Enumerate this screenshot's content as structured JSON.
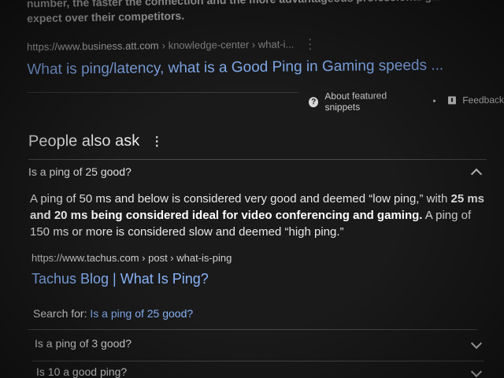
{
  "top_snippet": {
    "line1": "number, the faster the connection and the more advantageous professional gamers can",
    "line2": "expect over their competitors."
  },
  "result": {
    "cite_domain": "https://www.business.att.com",
    "cite_path": "› knowledge-center › what-i...",
    "title": "What is ping/latency, what is a Good Ping in Gaming speeds ..."
  },
  "featured_bar": {
    "about_label": "About featured snippets",
    "feedback_label": "Feedback"
  },
  "paa": {
    "heading": "People also ask",
    "more_icon": "⋮",
    "expanded": {
      "question": "Is a ping of 25 good?",
      "answer_part1": "A ping of 50 ms and below is considered very good and deemed “low ping,” with ",
      "answer_bold": "25 ms and 20 ms being considered ideal for video conferencing and gaming.",
      "answer_part2": " A ping of 150 ms or more is considered slow and deemed “high ping.”",
      "source_cite": "https://www.tachus.com › post › what-is-ping",
      "source_title": "Tachus Blog | What Is Ping?",
      "search_for_label": "Search for: ",
      "search_for_query": "Is a ping of 25 good?"
    },
    "collapsed": [
      {
        "question": "Is a ping of 3 good?"
      },
      {
        "question": "Is 10 a good ping?"
      }
    ]
  },
  "colors": {
    "background": "#1a1a1b",
    "link": "#8ab4f8",
    "text": "#e6e6e6"
  }
}
